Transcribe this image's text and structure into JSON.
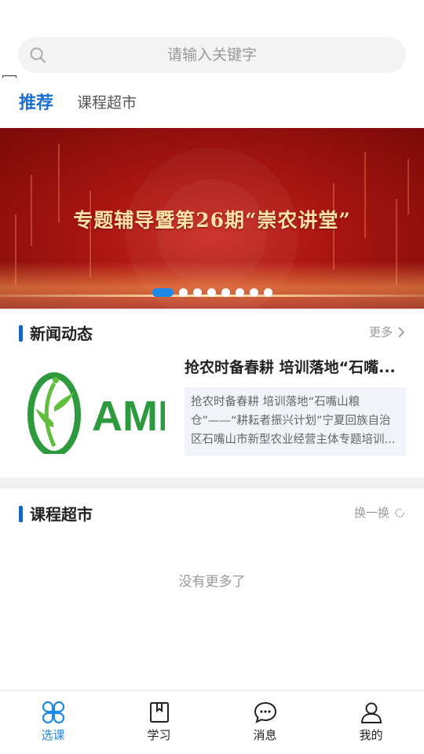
{
  "search": {
    "placeholder": "请输入关键字"
  },
  "tabs": [
    {
      "label": "推荐",
      "active": true
    },
    {
      "label": "课程超市",
      "active": false
    }
  ],
  "banner": {
    "title": "专题辅导暨第26期“崇农讲堂”",
    "slide_count": 8,
    "active_slide": 1
  },
  "news": {
    "title": "新闻动态",
    "more_label": "更多",
    "item": {
      "logo_text": "AMI",
      "headline": "抢农时备春耕 培训落地“石嘴...",
      "excerpt": "抢农时备春耕 培训落地“石嘴山粮仓”——“耕耘者振兴计划”宁夏回族自治区石嘴山市新型农业经营主体专题培训..."
    }
  },
  "courses": {
    "title": "课程超市",
    "refresh_label": "换一换",
    "empty_text": "没有更多了"
  },
  "bottom_nav": [
    {
      "label": "选课",
      "icon": "clover-icon",
      "active": true
    },
    {
      "label": "学习",
      "icon": "bookmark-icon",
      "active": false
    },
    {
      "label": "消息",
      "icon": "chat-bubble-icon",
      "active": false
    },
    {
      "label": "我的",
      "icon": "user-icon",
      "active": false
    }
  ],
  "colors": {
    "accent": "#1e88e5",
    "tab_active": "#1a6fd1",
    "section_bar": "#1565c0",
    "banner_red": "#a51410",
    "logo_green": "#2e9a3e"
  }
}
